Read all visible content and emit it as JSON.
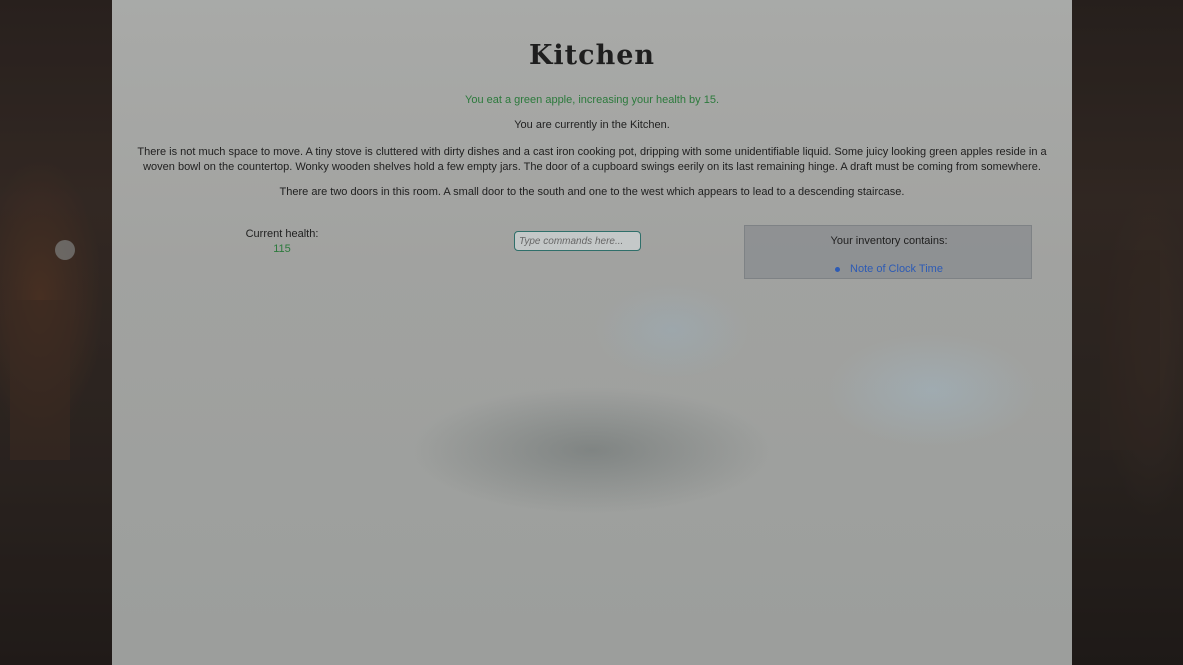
{
  "room": {
    "title": "Kitchen",
    "message": "You eat a green apple, increasing your health by 15.",
    "location": "You are currently in the Kitchen.",
    "description": "There is not much space to move. A tiny stove is cluttered with dirty dishes and a cast iron cooking pot, dripping with some unidentifiable liquid. Some juicy looking green apples reside in a woven bowl on the countertop. Wonky wooden shelves hold a few empty jars. The door of a cupboard swings eerily on its last remaining hinge. A draft must be coming from somewhere.",
    "exits": "There are two doors in this room. A small door to the south and one to the west which appears to lead to a descending staircase."
  },
  "health": {
    "label": "Current health:",
    "value": "115"
  },
  "command": {
    "placeholder": "Type commands here...",
    "value": ""
  },
  "inventory": {
    "title": "Your inventory contains:",
    "items": [
      {
        "label": "Note of Clock Time"
      }
    ]
  },
  "colors": {
    "message": "#2c7a3c",
    "health_value": "#2c7a3c",
    "inventory_link": "#2d5bb5",
    "input_border": "#2f6f6a"
  }
}
